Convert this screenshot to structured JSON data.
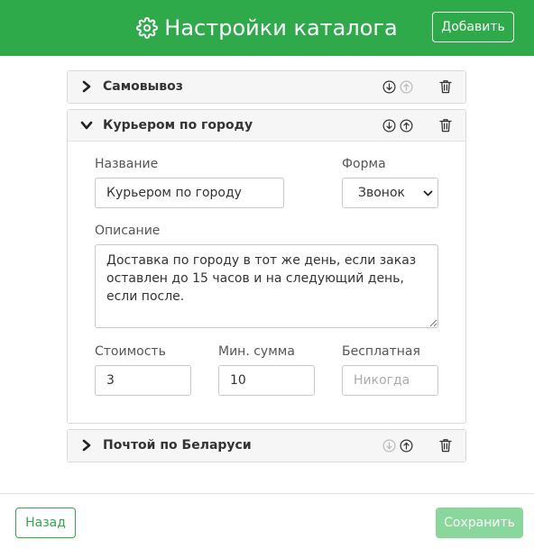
{
  "header": {
    "title": "Настройки каталога",
    "add_label": "Добавить",
    "bg_color": "#2eaa4a"
  },
  "methods": [
    {
      "title": "Самовывоз",
      "expanded": false,
      "move_down_enabled": true,
      "move_up_enabled": false
    },
    {
      "title": "Курьером по городу",
      "expanded": true,
      "move_down_enabled": true,
      "move_up_enabled": true,
      "fields": {
        "name_label": "Название",
        "name_value": "Курьером по городу",
        "form_label": "Форма",
        "form_value": "Звонок",
        "description_label": "Описание",
        "description_value": "Доставка по городу в тот же день, если заказ оставлен до 15 часов и на следующий день, если после.",
        "cost_label": "Стоимость",
        "cost_value": "3",
        "min_sum_label": "Мин. сумма",
        "min_sum_value": "10",
        "free_label": "Бесплатная",
        "free_placeholder": "Никогда"
      }
    },
    {
      "title": "Почтой по Беларуси",
      "expanded": false,
      "move_down_enabled": false,
      "move_up_enabled": true
    }
  ],
  "footer": {
    "back_label": "Назад",
    "save_label": "Сохранить",
    "save_enabled": false
  },
  "icons": {
    "gear": "gear-icon",
    "expand": "chevron-right-icon",
    "collapse": "chevron-down-icon",
    "move_down": "arrow-down-circle-icon",
    "move_up": "arrow-up-circle-icon",
    "delete": "trash-icon"
  }
}
